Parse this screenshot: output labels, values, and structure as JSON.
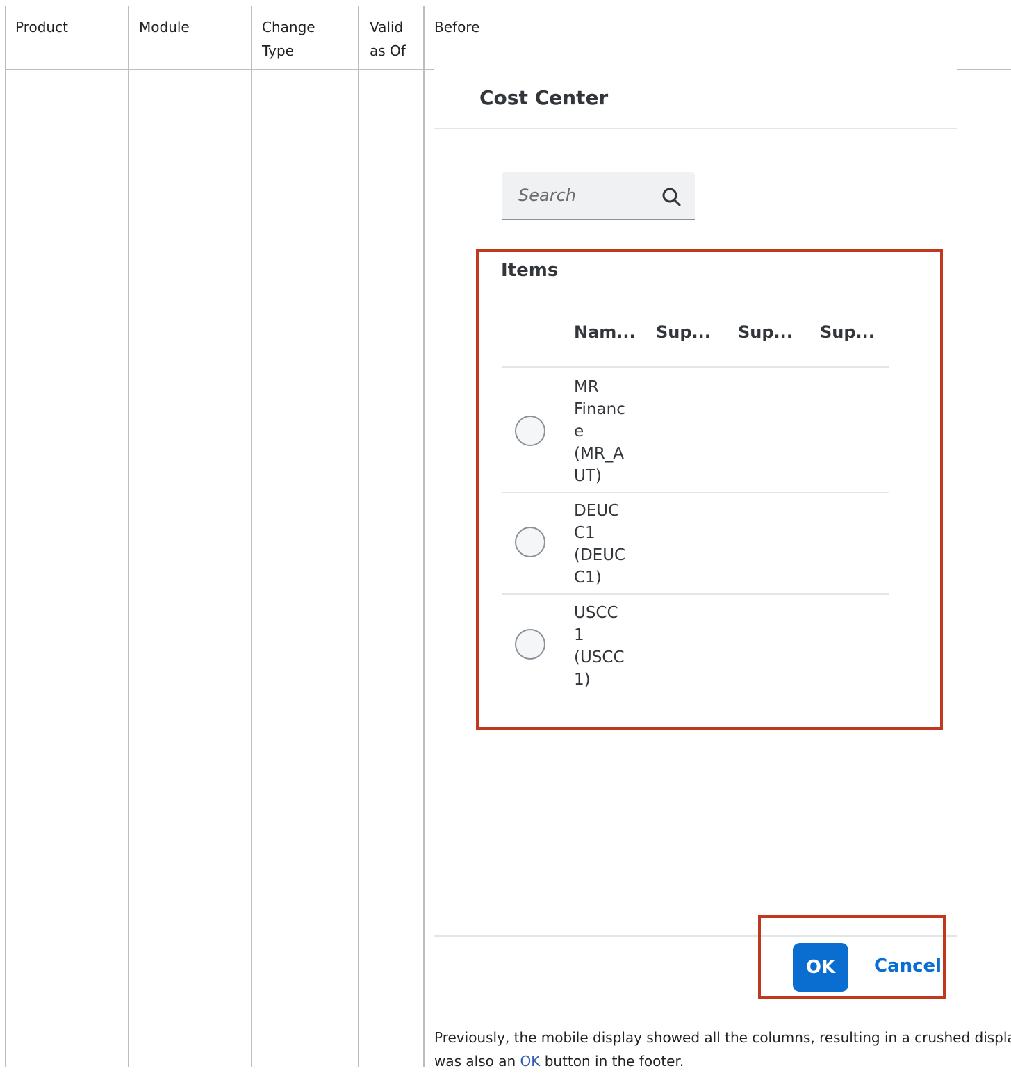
{
  "table": {
    "headers": {
      "product": "Product",
      "module": "Module",
      "change_type_line1": "Change",
      "change_type_line2": "Type",
      "valid_as_of_line1": "Valid",
      "valid_as_of_line2": "as Of",
      "before": "Before"
    }
  },
  "dialog": {
    "title": "Cost Center",
    "search": {
      "placeholder": "Search",
      "icon": "search-icon"
    },
    "items": {
      "title": "Items",
      "columns": [
        "Nam...",
        "Sup...",
        "Sup...",
        "Sup..."
      ],
      "rows": [
        {
          "name": "MR\nFinanc\ne\n(MR_A\nUT)"
        },
        {
          "name": "DEUC\nC1\n(DEUC\nC1)"
        },
        {
          "name": "USCC\n1\n(USCC\n1)"
        }
      ]
    },
    "footer": {
      "ok_label": "OK",
      "cancel_label": "Cancel"
    },
    "highlight_color": "#c0391f",
    "accent_color": "#0a6ed1"
  },
  "note": {
    "line1": "Previously, the mobile display showed all the columns, resulting in a crushed display. There",
    "line2_pre": "was also an ",
    "line2_link": "OK",
    "line2_post": " button in the footer."
  }
}
